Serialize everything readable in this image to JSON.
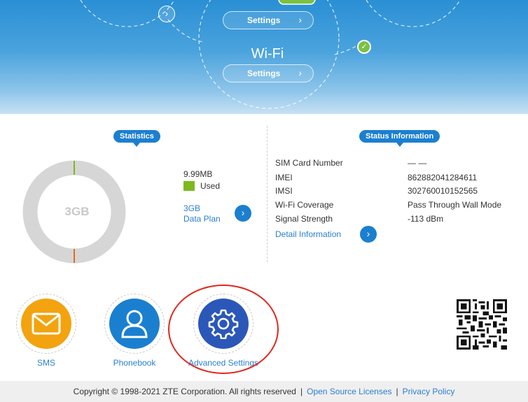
{
  "banner": {
    "top_settings_label": "Settings",
    "wifi_title": "Wi-Fi",
    "wifi_settings_label": "Settings"
  },
  "statistics": {
    "title": "Statistics",
    "donut_label": "3GB",
    "used_amount": "9.99MB",
    "used_label": "Used",
    "plan_size": "3GB",
    "plan_label": "Data Plan"
  },
  "status": {
    "title": "Status Information",
    "rows": [
      {
        "label": "SIM Card Number",
        "value": "— —"
      },
      {
        "label": "IMEI",
        "value": "862882041284611"
      },
      {
        "label": "IMSI",
        "value": "302760010152565"
      },
      {
        "label": "Wi-Fi Coverage",
        "value": "Pass Through Wall Mode"
      },
      {
        "label": "Signal Strength",
        "value": "-113 dBm"
      }
    ],
    "detail_link": "Detail Information"
  },
  "apps": [
    {
      "label": "SMS",
      "icon": "envelope-icon",
      "color": "#f2a30f"
    },
    {
      "label": "Phonebook",
      "icon": "person-icon",
      "color": "#1b7fd0"
    },
    {
      "label": "Advanced Settings",
      "icon": "gear-icon",
      "color": "#2b57b8"
    }
  ],
  "footer": {
    "copyright": "Copyright © 1998-2021 ZTE Corporation. All rights reserved",
    "open_source": "Open Source Licenses",
    "privacy": "Privacy Policy"
  },
  "colors": {
    "accent": "#1b7fd0",
    "used_green": "#7cba1f",
    "highlight_red": "#e0281e"
  }
}
